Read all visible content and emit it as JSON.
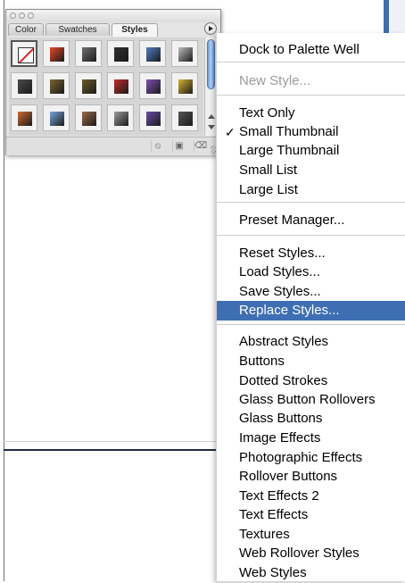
{
  "palette": {
    "tabs": [
      "Color",
      "Swatches",
      "Styles"
    ],
    "active_tab": "Styles",
    "style_swatches": [
      {
        "name": "none-style",
        "color": "#ffffff"
      },
      {
        "name": "glow-style",
        "color": "#e9472a"
      },
      {
        "name": "gray-style",
        "color": "#6f6f6f"
      },
      {
        "name": "dark-style",
        "color": "#2f2f2f"
      },
      {
        "name": "blue-style",
        "color": "#4f7fc4"
      },
      {
        "name": "light-gray-style",
        "color": "#bdbdbd"
      },
      {
        "name": "charcoal-style",
        "color": "#4b4b4b"
      },
      {
        "name": "bronze-style",
        "color": "#7a6632"
      },
      {
        "name": "olive-style",
        "color": "#6d5b2c"
      },
      {
        "name": "red-stripe-style",
        "color": "#c22a2a"
      },
      {
        "name": "rainbow-style",
        "color": "#7f4fb2"
      },
      {
        "name": "gold-style",
        "color": "#d7b233"
      },
      {
        "name": "sunset-style",
        "color": "#cf6a34"
      },
      {
        "name": "sky-style",
        "color": "#77a6de"
      },
      {
        "name": "landscape-style",
        "color": "#9a6b4a"
      },
      {
        "name": "chrome-style",
        "color": "#9c9c9c"
      },
      {
        "name": "purple-style",
        "color": "#6a4ca8"
      },
      {
        "name": "slate-style",
        "color": "#565656"
      }
    ]
  },
  "menu": {
    "items": [
      {
        "label": "Dock to Palette Well",
        "state": "normal"
      },
      {
        "label": "New Style...",
        "state": "disabled"
      },
      {
        "label": "Text Only",
        "state": "normal"
      },
      {
        "label": "Small Thumbnail",
        "state": "checked"
      },
      {
        "label": "Large Thumbnail",
        "state": "normal"
      },
      {
        "label": "Small List",
        "state": "normal"
      },
      {
        "label": "Large List",
        "state": "normal"
      },
      {
        "label": "Preset Manager...",
        "state": "normal"
      },
      {
        "label": "Reset Styles...",
        "state": "normal"
      },
      {
        "label": "Load Styles...",
        "state": "normal"
      },
      {
        "label": "Save Styles...",
        "state": "normal"
      },
      {
        "label": "Replace Styles...",
        "state": "highlighted"
      },
      {
        "label": "Abstract Styles",
        "state": "normal"
      },
      {
        "label": "Buttons",
        "state": "normal"
      },
      {
        "label": "Dotted Strokes",
        "state": "normal"
      },
      {
        "label": "Glass Button Rollovers",
        "state": "normal"
      },
      {
        "label": "Glass Buttons",
        "state": "normal"
      },
      {
        "label": "Image Effects",
        "state": "normal"
      },
      {
        "label": "Photographic Effects",
        "state": "normal"
      },
      {
        "label": "Rollover Buttons",
        "state": "normal"
      },
      {
        "label": "Text Effects 2",
        "state": "normal"
      },
      {
        "label": "Text Effects",
        "state": "normal"
      },
      {
        "label": "Textures",
        "state": "normal"
      },
      {
        "label": "Web Rollover Styles",
        "state": "normal"
      },
      {
        "label": "Web Styles",
        "state": "normal"
      }
    ],
    "check_glyph": "✓",
    "highlight_color": "#3e6fb3"
  }
}
